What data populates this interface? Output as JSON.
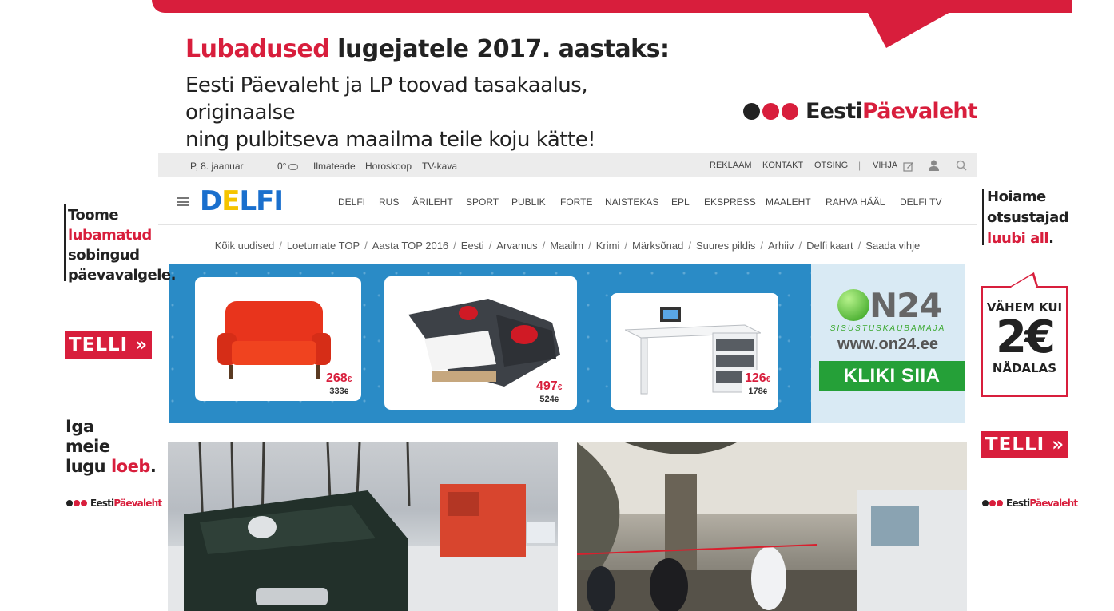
{
  "top_banner": {
    "headline_accent": "Lubadused",
    "headline_rest": "lugejatele 2017. aastaks:",
    "subline_1": "Eesti Päevaleht ja LP toovad tasakaalus, originaalse",
    "subline_2": "ning pulbitseva maailma teile koju kätte!",
    "logo_part1": "Eesti",
    "logo_part2": "Päevaleht",
    "brand_color": "#d81e3c"
  },
  "topbar": {
    "date": "P, 8. jaanuar",
    "temperature": "0°",
    "links": [
      "Ilmateade",
      "Horoskoop",
      "TV-kava"
    ],
    "right_links": [
      "REKLAAM",
      "KONTAKT",
      "OTSING"
    ],
    "divider": "|",
    "tip_label": "VIHJA",
    "icons": [
      "edit-icon",
      "user-icon",
      "search-icon"
    ]
  },
  "mainnav": {
    "logo": {
      "D": "D",
      "E": "E",
      "LFI": "LFI"
    },
    "logo_colors": {
      "blue": "#1a6fcd",
      "yellow": "#f5c400"
    },
    "items": [
      "DELFI",
      "RUS",
      "ÄRILEHT",
      "SPORT",
      "PUBLIK",
      "FORTE",
      "NAISTEKAS",
      "EPL",
      "EKSPRESS",
      "MAALEHT",
      "RAHVA HÄÄL",
      "DELFI TV"
    ]
  },
  "subnav": {
    "items": [
      "Kõik uudised",
      "Loetumate TOP",
      "Aasta TOP 2016",
      "Eesti",
      "Arvamus",
      "Maailm",
      "Krimi",
      "Märksõnad",
      "Suures pildis",
      "Arhiiv",
      "Delfi kaart",
      "Saada vihje"
    ],
    "separator": "/"
  },
  "furniture_ad": {
    "products": [
      {
        "name": "sofa",
        "price": "268",
        "old_price": "333"
      },
      {
        "name": "corner-sofa-bed",
        "price": "497",
        "old_price": "524"
      },
      {
        "name": "desk",
        "price": "126",
        "old_price": "178"
      }
    ],
    "currency": "€",
    "brand": "N24",
    "tagline": "SISUSTUSKAUBAMAJA",
    "url": "www.on24.ee",
    "cta": "KLIKI SIIA"
  },
  "left_ads": {
    "block1": {
      "line1": "Toome",
      "line2_accent": "lubamatud",
      "line3": "sobingud",
      "line4": "päevavalgele."
    },
    "telli_label": "TELLI",
    "block2": {
      "line1": "Iga",
      "line2": "meie",
      "line3a": "lugu",
      "line3_accent": "loeb",
      "line3_end": "."
    },
    "logo_part1": "Eesti",
    "logo_part2": "Päevaleht"
  },
  "right_ads": {
    "block1": {
      "line1": "Hoiame",
      "line2": "otsustajad",
      "line3_accent": "luubi all",
      "line3_end": "."
    },
    "badge": {
      "top": "VÄHEM KUI",
      "amount": "2€",
      "bottom": "NÄDALAS"
    },
    "telli_label": "TELLI",
    "logo_part1": "Eesti",
    "logo_part2": "Päevaleht"
  }
}
